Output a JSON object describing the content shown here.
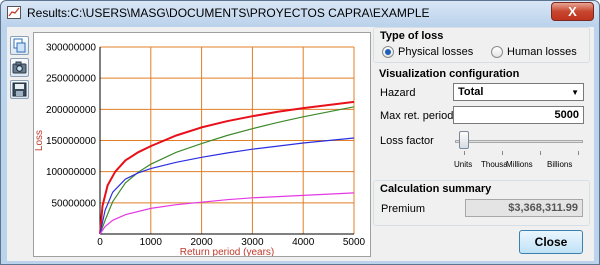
{
  "window": {
    "title": "Results:C:\\USERS\\MASG\\DOCUMENTS\\PROYECTOS CAPRA\\EXAMPLE",
    "close_glyph": "X"
  },
  "toolbar": {
    "buttons": [
      {
        "name": "copy-icon"
      },
      {
        "name": "camera-icon"
      },
      {
        "name": "save-icon"
      }
    ]
  },
  "type_of_loss": {
    "title": "Type of loss",
    "options": [
      {
        "label": "Physical losses",
        "selected": true
      },
      {
        "label": "Human losses",
        "selected": false
      }
    ]
  },
  "visualization": {
    "title": "Visualization configuration",
    "hazard_label": "Hazard",
    "hazard_value": "Total",
    "max_period_label": "Max ret. period",
    "max_period_value": "5000",
    "loss_factor_label": "Loss factor",
    "loss_factor_ticks": [
      "Units",
      "Thousa",
      "Millions",
      "Billions"
    ],
    "loss_factor_level": 0
  },
  "summary": {
    "title": "Calculation summary",
    "premium_label": "Premium",
    "premium_value": "$3,368,311.99"
  },
  "close_button_label": "Close",
  "colors": {
    "grid": "#e07f28",
    "axis_label": "#c0392b",
    "red": "#e8101a",
    "green": "#3d8a2c",
    "blue": "#2a2fe0",
    "magenta": "#e438e4"
  },
  "chart_data": {
    "type": "line",
    "xlabel": "Return period (years)",
    "ylabel": "Loss",
    "xlim": [
      0,
      5000
    ],
    "ylim": [
      0,
      300000000
    ],
    "x_ticks": [
      0,
      1000,
      2000,
      3000,
      4000,
      5000
    ],
    "y_ticks": [
      50000000,
      100000000,
      150000000,
      200000000,
      250000000,
      300000000
    ],
    "grid": true,
    "series": [
      {
        "color": "red",
        "x": [
          0,
          50,
          150,
          300,
          500,
          750,
          1000,
          1500,
          2000,
          2500,
          3000,
          3500,
          4000,
          4500,
          5000
        ],
        "y": [
          0,
          45000000,
          78000000,
          100000000,
          118000000,
          131000000,
          141000000,
          158000000,
          171000000,
          181000000,
          189000000,
          196000000,
          202000000,
          207000000,
          212000000
        ]
      },
      {
        "color": "green",
        "x": [
          0,
          100,
          250,
          500,
          750,
          1000,
          1500,
          2000,
          2500,
          3000,
          3500,
          4000,
          4500,
          5000
        ],
        "y": [
          0,
          22000000,
          52000000,
          82000000,
          99000000,
          112000000,
          131000000,
          145000000,
          158000000,
          169000000,
          179000000,
          188000000,
          196000000,
          204000000
        ]
      },
      {
        "color": "blue",
        "x": [
          0,
          100,
          250,
          500,
          750,
          1000,
          1500,
          2000,
          2500,
          3000,
          3500,
          4000,
          4500,
          5000
        ],
        "y": [
          0,
          38000000,
          67000000,
          88000000,
          98000000,
          105000000,
          115000000,
          123000000,
          130000000,
          136000000,
          141000000,
          146000000,
          150000000,
          154000000
        ]
      },
      {
        "color": "magenta",
        "x": [
          0,
          100,
          250,
          500,
          1000,
          1500,
          2000,
          2500,
          3000,
          3500,
          4000,
          4500,
          5000
        ],
        "y": [
          0,
          12000000,
          22000000,
          31000000,
          41000000,
          47000000,
          51000000,
          55000000,
          58000000,
          60000000,
          62000000,
          64000000,
          66000000
        ]
      }
    ]
  }
}
